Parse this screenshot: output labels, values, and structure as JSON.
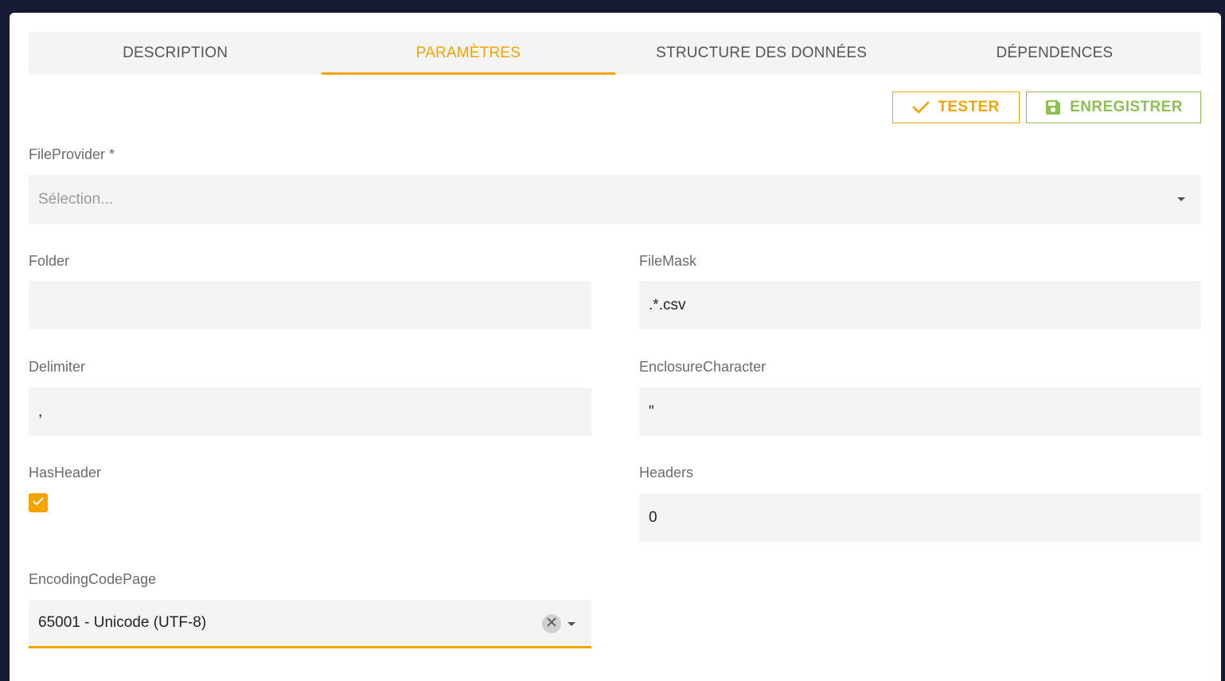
{
  "tabs": [
    {
      "label": "DESCRIPTION",
      "active": false
    },
    {
      "label": "PARAMÈTRES",
      "active": true
    },
    {
      "label": "STRUCTURE DES DONNÉES",
      "active": false
    },
    {
      "label": "DÉPENDENCES",
      "active": false
    }
  ],
  "actions": {
    "test_label": "TESTER",
    "test_icon": "check-icon",
    "save_label": "ENREGISTRER",
    "save_icon": "floppy-disk-icon"
  },
  "colors": {
    "accent": "#f5a300",
    "save": "#8cc152",
    "background": "#161b33",
    "field_bg": "#f4f4f4"
  },
  "form": {
    "file_provider": {
      "label": "FileProvider *",
      "placeholder": "Sélection..."
    },
    "folder": {
      "label": "Folder",
      "value": ""
    },
    "file_mask": {
      "label": "FileMask",
      "value": ".*.csv"
    },
    "delimiter": {
      "label": "Delimiter",
      "value": ","
    },
    "enclosure_character": {
      "label": "EnclosureCharacter",
      "value": "\""
    },
    "has_header": {
      "label": "HasHeader",
      "checked": true
    },
    "headers": {
      "label": "Headers",
      "value": "0"
    },
    "encoding_code_page": {
      "label": "EncodingCodePage",
      "value": "65001 - Unicode (UTF-8)"
    }
  }
}
